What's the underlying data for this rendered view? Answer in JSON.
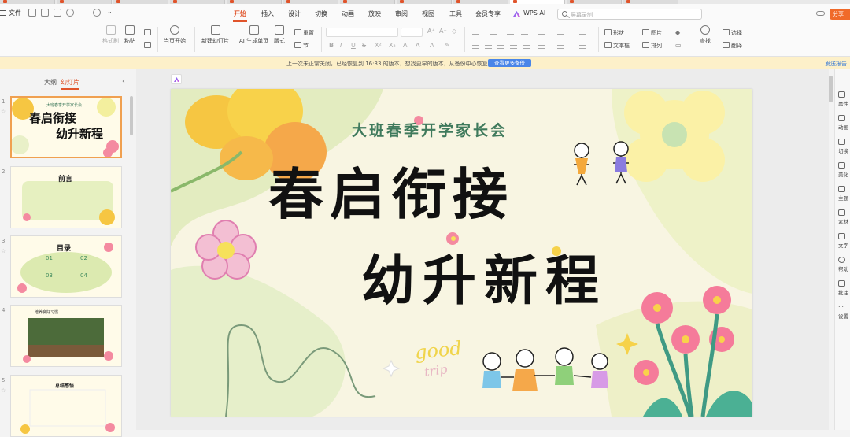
{
  "app": {
    "file_menu": "文件",
    "tabs": [
      "开始",
      "插入",
      "设计",
      "切换",
      "动画",
      "放映",
      "审阅",
      "视图",
      "工具",
      "会员专享",
      "WPS AI"
    ],
    "active_tab": "开始",
    "search_placeholder": "屏幕录制",
    "share_label": "分享"
  },
  "ribbon": {
    "format_painter": "格式刷",
    "paste": "粘贴",
    "play_from_current": "当页开始",
    "new_slide": "新建幻灯片",
    "ai_generate": "AI 生成单页",
    "layout": "版式",
    "reset": "重置",
    "section": "节",
    "shape": "形状",
    "textbox": "文本框",
    "picture": "图片",
    "arrange": "排列",
    "find": "查找",
    "select": "选择",
    "translate": "翻译"
  },
  "notice": {
    "text": "上一次未正常关闭，已经恢复到 16:33 的版本，想找更早的版本，从备份中心恢复",
    "button": "查看更多备份",
    "feedback": "发送报告"
  },
  "panel": {
    "tab_outline": "大纲",
    "tab_slides": "幻灯片",
    "thumbnails": [
      {
        "num": "1",
        "title": "春启衔接",
        "subtitle": "幼升新程",
        "header": "大班春季开学家长会"
      },
      {
        "num": "2",
        "title": "前言"
      },
      {
        "num": "3",
        "title": "目录",
        "items": [
          "01",
          "02",
          "03",
          "04"
        ]
      },
      {
        "num": "4",
        "title": "培养良好习惯"
      },
      {
        "num": "5",
        "title": "总结感悟"
      }
    ]
  },
  "slide": {
    "subtitle": "大班春季开学家长会",
    "title_line1": "春启衔接",
    "title_line2": "幼升新程",
    "deco_good": "good",
    "deco_trip": "trip"
  },
  "sidebar": {
    "items": [
      "属性",
      "动画",
      "切换",
      "美化",
      "主题",
      "素材",
      "文字",
      "帮助",
      "批注",
      "设置"
    ]
  },
  "colors": {
    "accent": "#e0542b",
    "subtitle_green": "#3f7a5c",
    "notice_bg": "#fdf0c9",
    "slide_bg": "#f8f5e2"
  }
}
